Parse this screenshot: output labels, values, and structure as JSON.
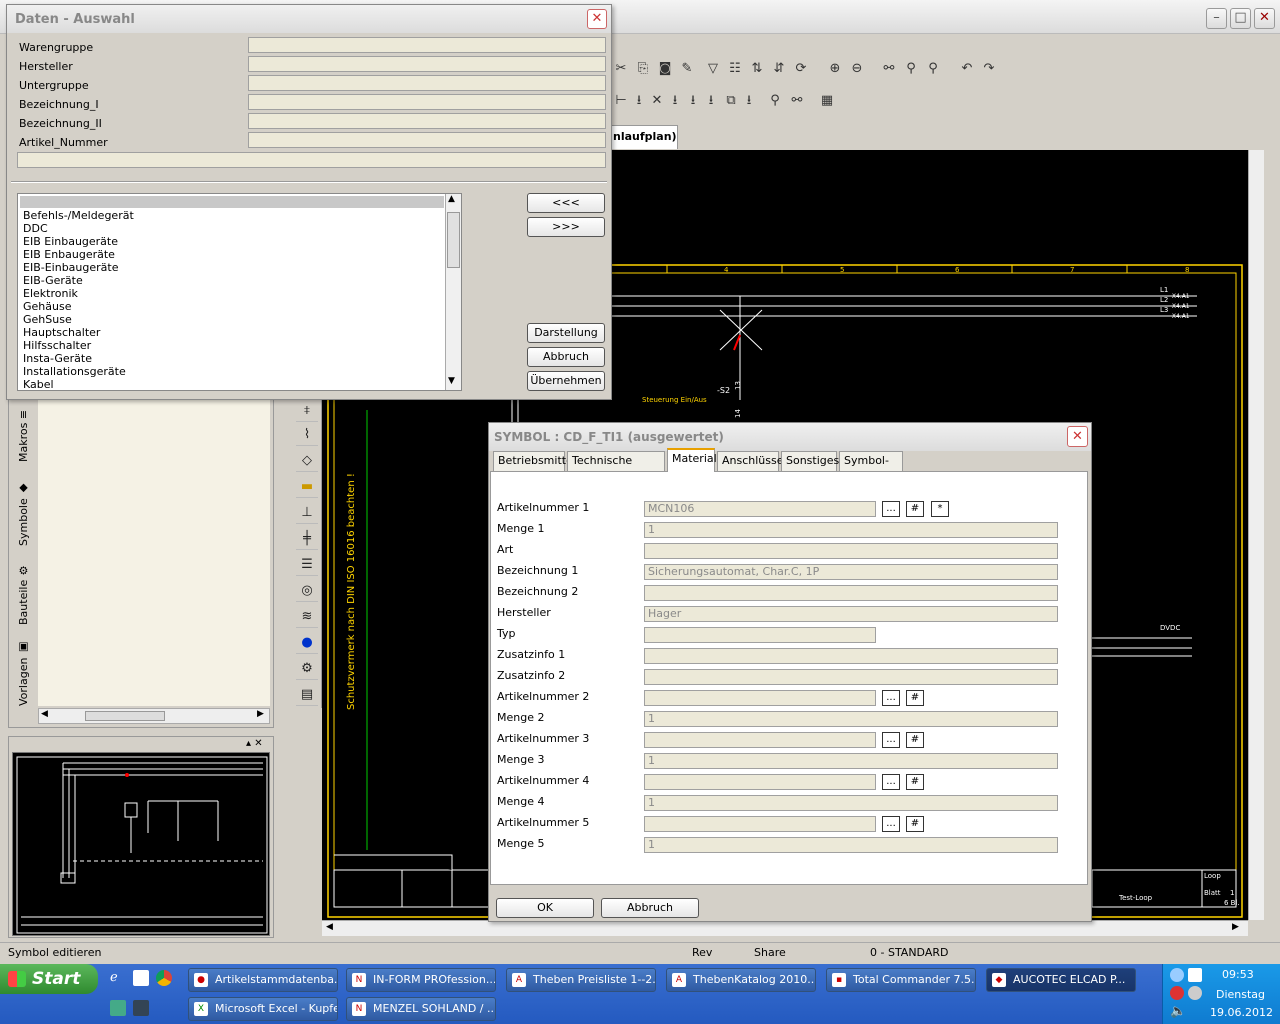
{
  "main_window": {
    "tab_title": "nlaufplan)",
    "status_text": "Symbol editieren",
    "status_rev": "Rev",
    "status_share": "Share",
    "status_layer": "0 - STANDARD"
  },
  "sidebar": {
    "tabs": [
      "Makros",
      "Symbole",
      "Bauteile",
      "Vorlagen"
    ]
  },
  "drawing": {
    "vertical_text_1": "Schutzvermerk nach DIN ISO 16016 beachten !",
    "label_steuerung": "Steuerung Ein/Aus",
    "label_s2": "-S2",
    "label_13": "13",
    "label_14": "14",
    "col_numbers": [
      "4",
      "5",
      "6",
      "7",
      "8"
    ],
    "phase_labels": [
      "L1",
      "L2",
      "L3"
    ],
    "xa_labels": [
      "-X4.A1",
      "-X4.A1",
      "-X4.A1"
    ],
    "dvdc": "DVDC",
    "test_loop": "Test-Loop",
    "loop": "Loop",
    "blatt": "Blatt",
    "blatt_no": "1",
    "bl": "6 Bl."
  },
  "daten_dialog": {
    "title": "Daten - Auswahl",
    "fields": [
      {
        "label": "Warengruppe",
        "value": ""
      },
      {
        "label": "Hersteller",
        "value": ""
      },
      {
        "label": "Untergruppe",
        "value": ""
      },
      {
        "label": "Bezeichnung_I",
        "value": ""
      },
      {
        "label": "Bezeichnung_II",
        "value": ""
      },
      {
        "label": "Artikel_Nummer",
        "value": ""
      }
    ],
    "list_items": [
      "Befehls-/Meldegerät",
      "DDC",
      "EIB Einbaugeräte",
      "EIB Enbaugeräte",
      "EIB-Einbaugeräte",
      "EIB-Geräte",
      "Elektronik",
      "Gehäuse",
      "GehSuse",
      "Hauptschalter",
      "Hilfsschalter",
      "Insta-Geräte",
      "Installationsgeräte",
      "Kabel"
    ],
    "btn_prev": "<<<",
    "btn_next": ">>>",
    "btn_darstellung": "Darstellung",
    "btn_abbruch": "Abbruch",
    "btn_uebernehmen": "Übernehmen"
  },
  "symbol_dialog": {
    "title": "SYMBOL : CD_F_TI1  (ausgewertet)",
    "tabs": [
      "Betriebsmittel",
      "Technische Daten",
      "Material",
      "Anschlüsse",
      "Sonstiges",
      "Symbol-Info"
    ],
    "active_tab": "Material",
    "rows": [
      {
        "label": "Artikelnummer 1",
        "value": "MCN106"
      },
      {
        "label": "Menge 1",
        "value": "1"
      },
      {
        "label": "Art",
        "value": ""
      },
      {
        "label": "Bezeichnung 1",
        "value": "Sicherungsautomat, Char.C, 1P"
      },
      {
        "label": "Bezeichnung 2",
        "value": ""
      },
      {
        "label": "Hersteller",
        "value": "Hager"
      },
      {
        "label": "Typ",
        "value": ""
      },
      {
        "label": "Zusatzinfo 1",
        "value": ""
      },
      {
        "label": "Zusatzinfo 2",
        "value": ""
      },
      {
        "label": "Artikelnummer 2",
        "value": ""
      },
      {
        "label": "Menge 2",
        "value": "1"
      },
      {
        "label": "Artikelnummer 3",
        "value": ""
      },
      {
        "label": "Menge 3",
        "value": "1"
      },
      {
        "label": "Artikelnummer 4",
        "value": ""
      },
      {
        "label": "Menge 4",
        "value": "1"
      },
      {
        "label": "Artikelnummer 5",
        "value": ""
      },
      {
        "label": "Menge 5",
        "value": "1"
      }
    ],
    "dots": "...",
    "hash": "#",
    "star": "*",
    "btn_ok": "OK",
    "btn_abbruch": "Abbruch"
  },
  "taskbar": {
    "start": "Start",
    "items": [
      "Artikelstammdatenba...",
      "IN-FORM PROfession...",
      "Theben Preisliste 1--2...",
      "ThebenKatalog 2010...",
      "Total Commander 7.5...",
      "AUCOTEC    ELCAD P...",
      "Microsoft Excel - Kupfer",
      "MENZEL SOHLAND / ..."
    ],
    "time": "09:53",
    "day": "Dienstag",
    "date": "19.06.2012"
  }
}
